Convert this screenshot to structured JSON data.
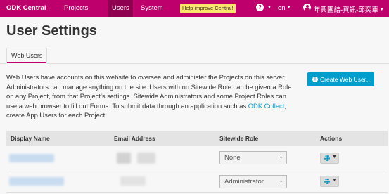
{
  "topnav": {
    "brand": "ODK Central",
    "links": [
      "Projects",
      "Users",
      "System"
    ],
    "help": "Help improve Central!",
    "help_icon": "?",
    "language": "en",
    "username": "年興團結-資訊-邱奕車"
  },
  "page": {
    "title": "User Settings",
    "tab": "Web Users"
  },
  "intro": {
    "text_before_link": "Web Users have accounts on this website to oversee and administer the Projects on this server. Administrators can manage anything on the site. Users with no Sitewide Role can be given a Role on any Project, from that Project’s settings. Sitewide Administrators and some Project Roles can use a web browser to fill out Forms. To submit data through an application such as ",
    "link": "ODK Collect",
    "text_after_link": ", create App Users for each Project."
  },
  "create_button": "Create Web User…",
  "table": {
    "headers": [
      "Display Name",
      "Email Address",
      "Sitewide Role",
      "Actions"
    ],
    "rows": [
      {
        "role": "None"
      },
      {
        "role": "Administrator"
      }
    ]
  },
  "colors": {
    "brand": "#bd006b",
    "accent": "#009ecc",
    "help_badge": "#ffe66b"
  }
}
